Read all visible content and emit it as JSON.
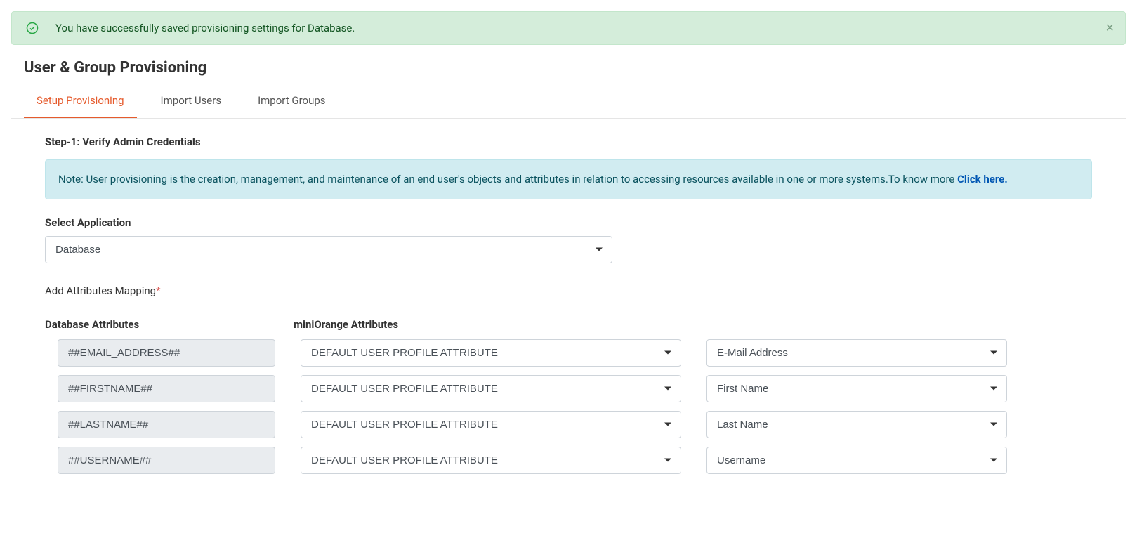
{
  "alert": {
    "text": "You have successfully saved provisioning settings for Database."
  },
  "page_title": "User & Group Provisioning",
  "tabs": [
    {
      "label": "Setup Provisioning",
      "active": true
    },
    {
      "label": "Import Users",
      "active": false
    },
    {
      "label": "Import Groups",
      "active": false
    }
  ],
  "step_title": "Step-1: Verify Admin Credentials",
  "info": {
    "note_prefix": "Note: User provisioning is the creation, management, and maintenance of an end user's objects and attributes in relation to accessing resources available in one or more systems.To know more ",
    "link_text": "Click here."
  },
  "select_application": {
    "label": "Select Application",
    "value": "Database"
  },
  "attributes_mapping": {
    "label": "Add Attributes Mapping",
    "col1_header": "Database Attributes",
    "col2_header": "miniOrange Attributes",
    "rows": [
      {
        "db_attr": "##EMAIL_ADDRESS##",
        "profile_type": "DEFAULT USER PROFILE ATTRIBUTE",
        "mo_attr": "E-Mail Address"
      },
      {
        "db_attr": "##FIRSTNAME##",
        "profile_type": "DEFAULT USER PROFILE ATTRIBUTE",
        "mo_attr": "First Name"
      },
      {
        "db_attr": "##LASTNAME##",
        "profile_type": "DEFAULT USER PROFILE ATTRIBUTE",
        "mo_attr": "Last Name"
      },
      {
        "db_attr": "##USERNAME##",
        "profile_type": "DEFAULT USER PROFILE ATTRIBUTE",
        "mo_attr": "Username"
      }
    ]
  }
}
